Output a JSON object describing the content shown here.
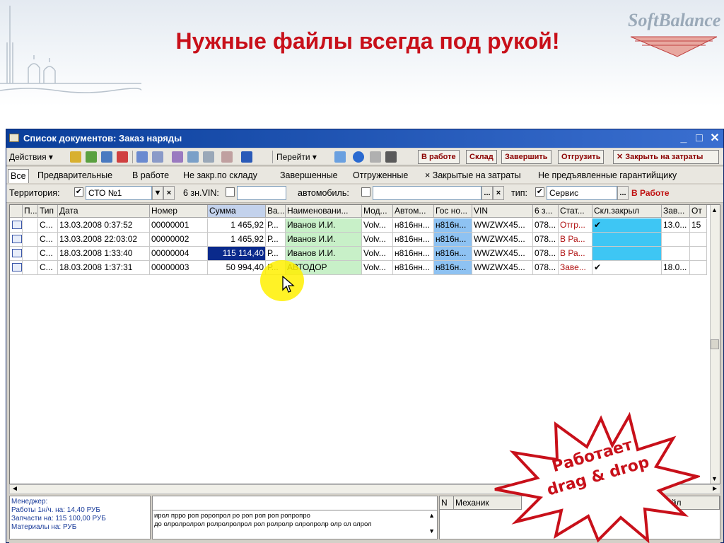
{
  "slide": {
    "title": "Нужные файлы всегда под рукой!",
    "logo": "SoftBalance",
    "callout": [
      "Работает",
      "drag & drop"
    ],
    "colors": {
      "title": "#c8101a",
      "window_title": "#0a3e9a",
      "hl": "#0a2a8c"
    }
  },
  "window": {
    "title": "Список документов: Заказ наряды",
    "controls": {
      "minimize": "_",
      "maximize": "□",
      "close": "✕"
    }
  },
  "toolbar": {
    "actions": "Действия ▾",
    "goto": "Перейти ▾",
    "btn_in_work": "В работе",
    "btn_warehouse": "Склад",
    "btn_finish": "Завершить",
    "btn_ship": "Отгрузить",
    "btn_close_costs": "✕ Закрыть на затраты"
  },
  "tabs": [
    "Все",
    "Предварительные",
    "В работе",
    "Не закр.по складу",
    "Завершенные",
    "Отгруженные",
    "× Закрытые на затраты",
    "Не предъявленные гарантийщику"
  ],
  "filter": {
    "territory_label": "Территория:",
    "territory_value": "СТО №1",
    "vin_label": "6 зн.VIN:",
    "car_label": "автомобиль:",
    "type_label": "тип:",
    "type_value": "Сервис",
    "status": "В Работе",
    "checkmark": "✔",
    "ellipsis": "...",
    "x": "×"
  },
  "grid": {
    "headers": [
      "П...",
      "Тип",
      "Дата",
      "Номер",
      "Сумма",
      "Ва...",
      "Наименовани...",
      "Мод...",
      "Автом...",
      "Гос но...",
      "VIN",
      "6 з...",
      "Стат...",
      "Скл.закрыл",
      "Зав...",
      "От"
    ],
    "rows": [
      [
        "С...",
        "13.03.2008 0:37:52",
        "00000001",
        "1 465,92",
        "Р...",
        "Иванов И.И.",
        "Volv...",
        "н816нн...",
        "н816н...",
        "WWZWX45...",
        "078...",
        "Отгр...",
        "✔",
        "13.0...",
        "15"
      ],
      [
        "С...",
        "13.03.2008 22:03:02",
        "00000002",
        "1 465,92",
        "Р...",
        "Иванов И.И.",
        "Volv...",
        "н816нн...",
        "н816н...",
        "WWZWX45...",
        "078...",
        "В Ра...",
        "",
        "",
        ""
      ],
      [
        "С...",
        "18.03.2008 1:33:40",
        "00000004",
        "115 114,40",
        "Р...",
        "Иванов И.И.",
        "Volv...",
        "н816нн...",
        "н816н...",
        "WWZWX45...",
        "078...",
        "В Ра...",
        "",
        "",
        ""
      ],
      [
        "С...",
        "18.03.2008 1:37:31",
        "00000003",
        "50 994,40",
        "Р...",
        "АВТОДОР",
        "Volv...",
        "н816нн...",
        "н816н...",
        "WWZWX45...",
        "078...",
        "Заве...",
        "✔",
        "18.0...",
        ""
      ]
    ]
  },
  "bottom": {
    "manager": [
      "Менеджер:",
      "Работы 1н/ч. на: 14,40 РУБ",
      "Запчасти на: 115 100,00 РУБ",
      "Материалы на:  РУБ"
    ],
    "memo": [
      "ирол прро роп роропрол ро роп роп роп ропропро",
      "до олролролрол ролролролрол рол ролролр олролролр олр ол олрол"
    ],
    "col_n": "N",
    "col_mech": "Механик",
    "col_file": "Файл"
  }
}
